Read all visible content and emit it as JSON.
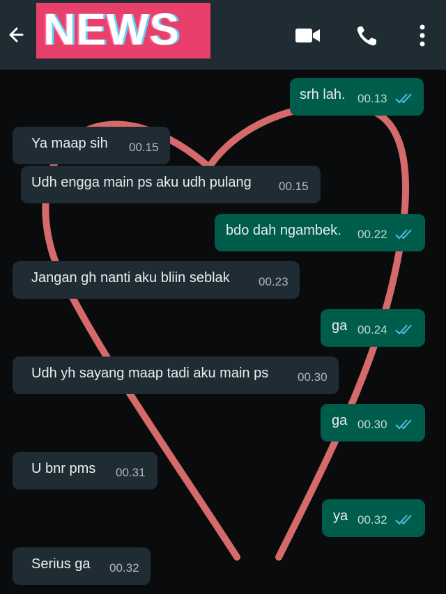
{
  "header": {
    "badge_text": "NEWS",
    "icons": [
      "back-arrow-icon",
      "video-call-icon",
      "phone-icon",
      "more-options-icon"
    ]
  },
  "messages": [
    {
      "dir": "out",
      "text": "srh lah.",
      "time": "00.13",
      "read": true
    },
    {
      "dir": "in",
      "text": "Ya maap sih",
      "time": "00.15"
    },
    {
      "dir": "in",
      "text": "Udh engga main ps aku udh pulang",
      "time": "00.15"
    },
    {
      "dir": "out",
      "text": "bdo dah ngambek.",
      "time": "00.22",
      "read": true
    },
    {
      "dir": "in",
      "text": "Jangan gh nanti aku bliin seblak",
      "time": "00.23"
    },
    {
      "dir": "out",
      "text": "ga",
      "time": "00.24",
      "read": true
    },
    {
      "dir": "in",
      "text": "Udh yh sayang maap tadi aku main ps",
      "time": "00.30"
    },
    {
      "dir": "out",
      "text": "ga",
      "time": "00.30",
      "read": true
    },
    {
      "dir": "in",
      "text": "U bnr pms",
      "time": "00.31"
    },
    {
      "dir": "out",
      "text": "ya",
      "time": "00.32",
      "read": true
    },
    {
      "dir": "in",
      "text": "Serius ga",
      "time": "00.32"
    }
  ],
  "colors": {
    "header_bg": "#1f2c34",
    "incoming_bubble": "#202c33",
    "outgoing_bubble": "#005c4b",
    "read_ticks": "#53bdeb",
    "badge": "#e8406b",
    "heart_outline": "#d46a6a"
  }
}
